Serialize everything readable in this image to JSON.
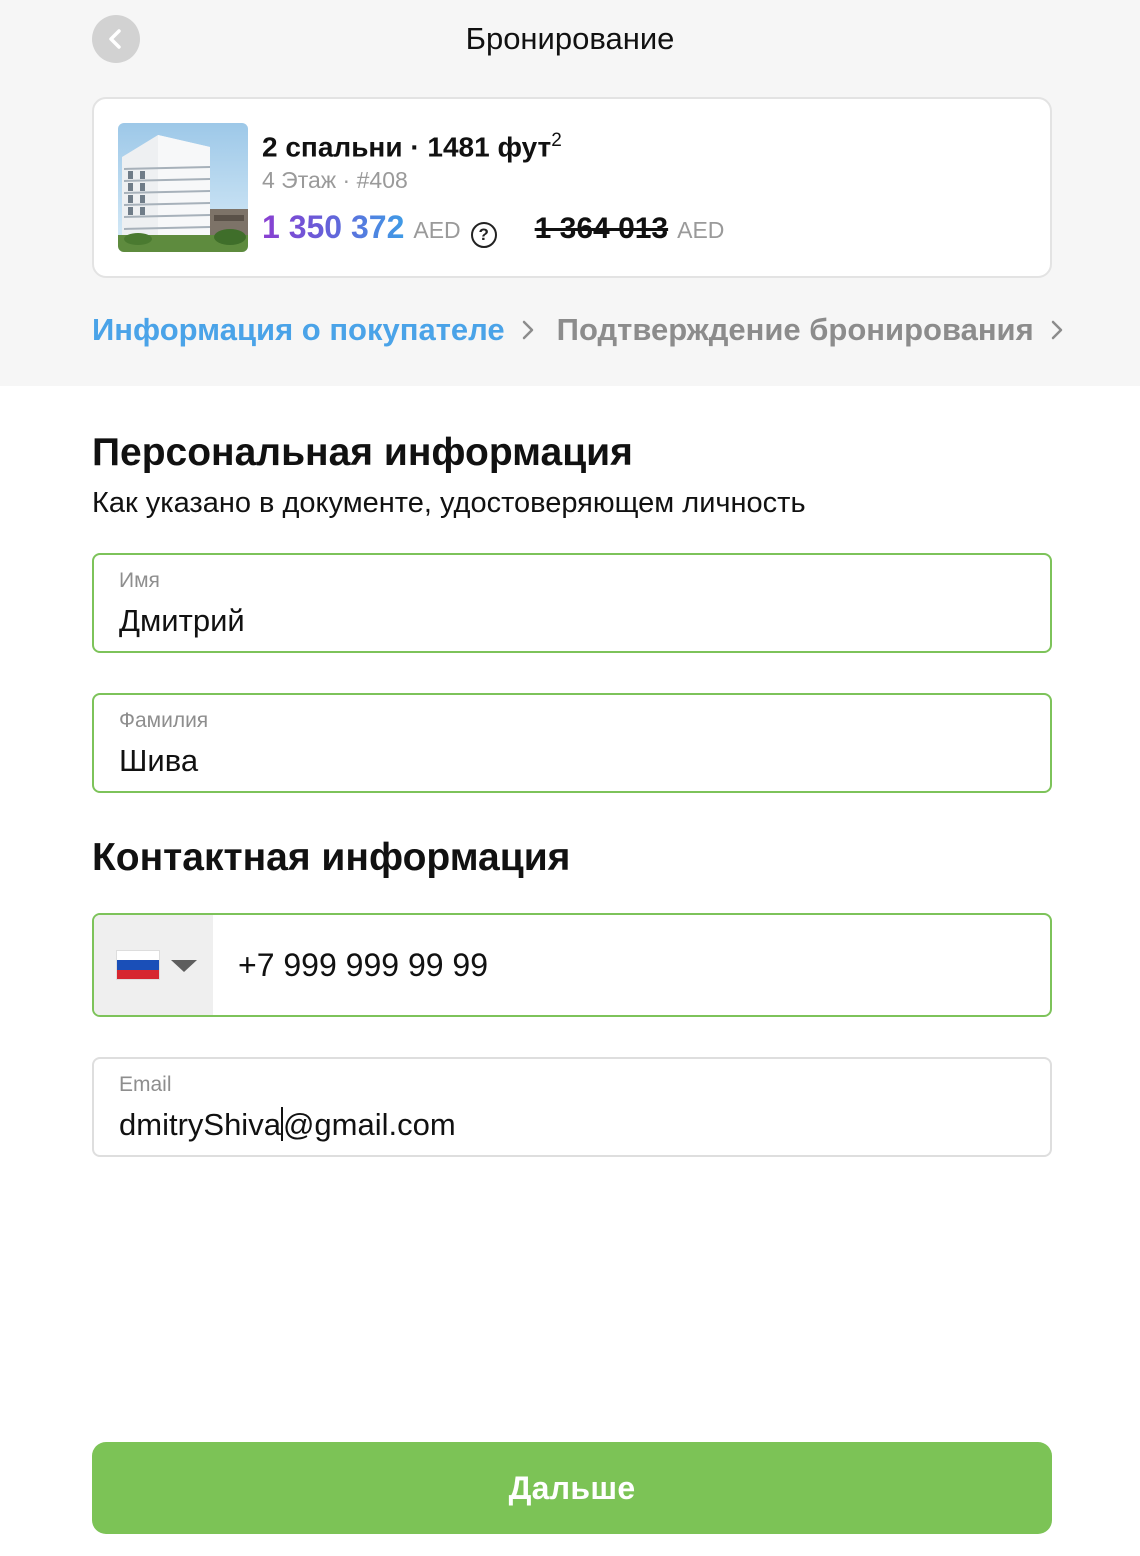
{
  "header": {
    "title": "Бронирование"
  },
  "listing": {
    "title_main": "2 спальни · 1481 фут",
    "title_sup": "2",
    "subtitle": "4 Этаж · #408",
    "price_current": "1 350 372",
    "currency": "AED",
    "help_symbol": "?",
    "price_old": "1 364 013",
    "currency_old": "AED",
    "price_colors": [
      "#8a3fd1",
      "#3f9be6"
    ]
  },
  "steps": [
    {
      "label": "Информация о покупателе",
      "state": "active"
    },
    {
      "label": "Подтверждение бронирования",
      "state": "inactive"
    }
  ],
  "personal": {
    "title": "Персональная информация",
    "subtitle": "Как указано в документе, удостоверяющем личность",
    "first_name": {
      "label": "Имя",
      "value": "Дмитрий"
    },
    "last_name": {
      "label": "Фамилия",
      "value": "Шива"
    }
  },
  "contact": {
    "title": "Контактная информация",
    "phone": {
      "country": "Russia",
      "flag": "ru-flag-icon",
      "value": "+7 999 999 99 99"
    },
    "email": {
      "label": "Email",
      "value_before_caret": "dmitryShiva",
      "value_after_caret": "@gmail.com"
    }
  },
  "footer": {
    "next_label": "Дальше"
  },
  "colors": {
    "accent_green": "#7cc356",
    "field_border_valid": "#7dc35a",
    "step_active": "#4aa3e8"
  }
}
